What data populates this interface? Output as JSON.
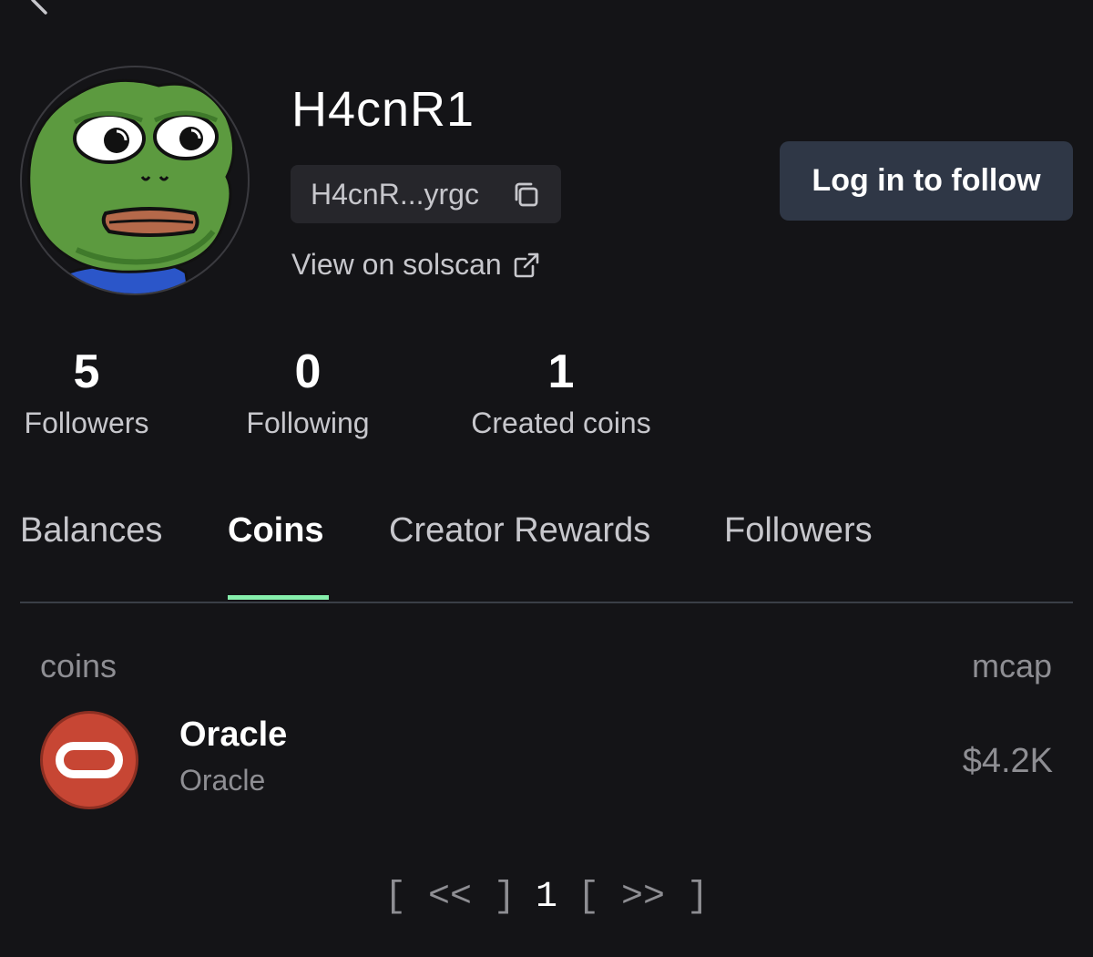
{
  "profile": {
    "username": "H4cnR1",
    "address_short": "H4cnR...yrgc",
    "solscan_label": "View on solscan",
    "follow_button": "Log in to follow"
  },
  "stats": [
    {
      "value": "5",
      "label": "Followers"
    },
    {
      "value": "0",
      "label": "Following"
    },
    {
      "value": "1",
      "label": "Created coins"
    }
  ],
  "tabs": [
    {
      "label": "Balances",
      "active": false
    },
    {
      "label": "Coins",
      "active": true
    },
    {
      "label": "Creator Rewards",
      "active": false
    },
    {
      "label": "Followers",
      "active": false
    }
  ],
  "table": {
    "headers": {
      "coins": "coins",
      "mcap": "mcap"
    },
    "rows": [
      {
        "name": "Oracle",
        "ticker": "Oracle",
        "mcap": "$4.2K"
      }
    ]
  },
  "pagination": {
    "prev": "[ << ]",
    "current": "1",
    "next": "[ >> ]"
  },
  "colors": {
    "background": "#141417",
    "follow_button_bg": "#2f3746",
    "tab_accent": "#86efac",
    "coin_logo": "#c74634"
  },
  "icons": {
    "back": "chevron-left-icon",
    "copy": "copy-icon",
    "external": "external-link-icon"
  }
}
